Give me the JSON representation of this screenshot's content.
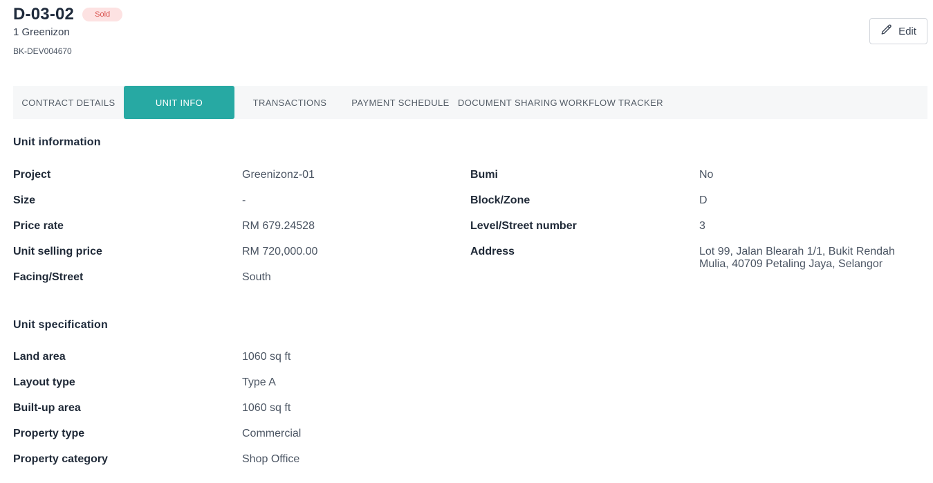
{
  "header": {
    "unit_code": "D-03-02",
    "status": "Sold",
    "subtitle": "1 Greenizon",
    "reference": "BK-DEV004670"
  },
  "actions": {
    "edit_label": "Edit",
    "edit_icon": "pencil-icon"
  },
  "tabs": [
    {
      "label": "CONTRACT DETAILS",
      "active": false
    },
    {
      "label": "UNIT INFO",
      "active": true
    },
    {
      "label": "TRANSACTIONS",
      "active": false
    },
    {
      "label": "PAYMENT SCHEDULE",
      "active": false
    },
    {
      "label": "DOCUMENT SHARING",
      "active": false
    },
    {
      "label": "WORKFLOW TRACKER",
      "active": false
    }
  ],
  "unit_information": {
    "title": "Unit information",
    "left": [
      {
        "label": "Project",
        "value": "Greenizonz-01"
      },
      {
        "label": "Size",
        "value": "-"
      },
      {
        "label": "Price rate",
        "value": "RM 679.24528"
      },
      {
        "label": "Unit selling price",
        "value": "RM 720,000.00"
      },
      {
        "label": "Facing/Street",
        "value": "South"
      }
    ],
    "right": [
      {
        "label": "Bumi",
        "value": "No"
      },
      {
        "label": "Block/Zone",
        "value": "D"
      },
      {
        "label": "Level/Street number",
        "value": "3"
      },
      {
        "label": "Address",
        "value": "Lot 99, Jalan Blearah 1/1, Bukit Rendah Mulia, 40709 Petaling Jaya, Selangor"
      }
    ]
  },
  "unit_specification": {
    "title": "Unit specification",
    "rows": [
      {
        "label": "Land area",
        "value": "1060 sq ft"
      },
      {
        "label": "Layout type",
        "value": "Type A"
      },
      {
        "label": "Built-up area",
        "value": "1060 sq ft"
      },
      {
        "label": "Property type",
        "value": "Commercial"
      },
      {
        "label": "Property category",
        "value": "Shop Office"
      }
    ]
  },
  "colors": {
    "accent": "#27a9a3",
    "status_bg": "#fde2e2",
    "status_text": "#d9534f"
  }
}
